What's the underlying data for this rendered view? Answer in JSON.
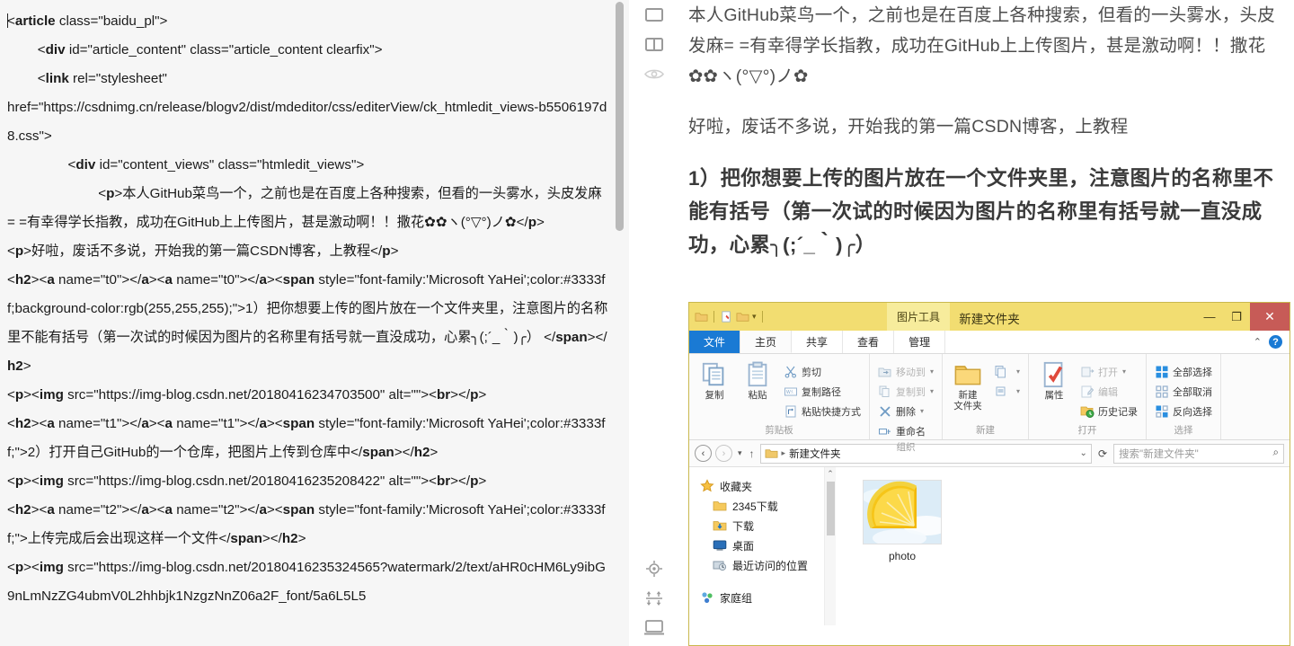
{
  "editor": {
    "code_lines": [
      {
        "text": "<article class=\"baidu_pl\">",
        "indent": 0,
        "caret": true
      },
      {
        "text": "<div id=\"article_content\" class=\"article_content clearfix\">",
        "indent": 1
      },
      {
        "text": "<link rel=\"stylesheet\"",
        "indent": 1
      },
      {
        "text": "href=\"https://csdnimg.cn/release/blogv2/dist/mdeditor/css/editerView/ck_htmledit_views-b5506197d8.css\">",
        "indent": 0
      },
      {
        "text": "<div id=\"content_views\" class=\"htmledit_views\">",
        "indent": 2
      },
      {
        "text": "<p>本人GitHub菜鸟一个，之前也是在百度上各种搜索，但看的一头雾水，头皮发麻= =有幸得学长指教，成功在GitHub上上传图片，甚是激动啊！！撒花✿✿ヽ(°▽°)ノ✿</p>",
        "indent": 3
      },
      {
        "text": "<p>好啦，废话不多说，开始我的第一篇CSDN博客，上教程</p>",
        "indent": 0
      },
      {
        "text": "<h2><a name=\"t0\"></a><a name=\"t0\"></a><span style=\"font-family:'Microsoft YaHei';color:#3333ff;background-color:rgb(255,255,255);\">1）把你想要上传的图片放在一个文件夹里，注意图片的名称里不能有括号（第一次试的时候因为图片的名称里有括号就一直没成功，心累╮(;´_｀)╭） </span></h2>",
        "indent": 0
      },
      {
        "text": "<p><img src=\"https://img-blog.csdn.net/20180416234703500\" alt=\"\"><br></p>",
        "indent": 0
      },
      {
        "text": "<h2><a name=\"t1\"></a><a name=\"t1\"></a><span style=\"font-family:'Microsoft YaHei';color:#3333ff;\">2）打开自己GitHub的一个仓库，把图片上传到仓库中</span></h2>",
        "indent": 0
      },
      {
        "text": "<p><img src=\"https://img-blog.csdn.net/20180416235208422\" alt=\"\"><br></p>",
        "indent": 0
      },
      {
        "text": "<h2><a name=\"t2\"></a><a name=\"t2\"></a><span style=\"font-family:'Microsoft YaHei';color:#3333ff;\">上传完成后会出现这样一个文件</span></h2>",
        "indent": 0
      },
      {
        "text": "<p><img src=\"https://img-blog.csdn.net/20180416235324565?watermark/2/text/aHR0cHM6Ly9ibG9nLmNzZG4ubmV0L2hhbjk1NzgzNnZ06a2F_font/5a6L5L5",
        "indent": 0
      }
    ]
  },
  "rail": {
    "items": [
      {
        "name": "single-pane-icon",
        "title": "single pane"
      },
      {
        "name": "split-pane-icon",
        "title": "split pane"
      },
      {
        "name": "eye-preview-icon",
        "title": "preview"
      }
    ],
    "bottom_items": [
      {
        "name": "target-sync-icon",
        "title": "sync scroll"
      },
      {
        "name": "expand-arrows-icon",
        "title": "fit"
      },
      {
        "name": "monitor-icon",
        "title": "fullscreen"
      }
    ]
  },
  "preview": {
    "paragraph_1": "本人GitHub菜鸟一个，之前也是在百度上各种搜索，但看的一头雾水，头皮发麻= =有幸得学长指教，成功在GitHub上上传图片，甚是激动啊！！撒花✿✿ヽ(°▽°)ノ✿",
    "paragraph_2": "好啦，废话不多说，开始我的第一篇CSDN博客，上教程",
    "heading_1": "1）把你想要上传的图片放在一个文件夹里，注意图片的名称里不能有括号（第一次试的时候因为图片的名称里有括号就一直没成功，心累╮(;´_｀)╭）"
  },
  "explorer": {
    "title": "新建文件夹",
    "contextual_tab": "图片工具",
    "window_buttons": {
      "minimize": "—",
      "maximize": "❐",
      "close": "✕"
    },
    "tabs": [
      {
        "label": "文件",
        "kind": "file"
      },
      {
        "label": "主页",
        "kind": "active"
      },
      {
        "label": "共享",
        "kind": "normal"
      },
      {
        "label": "查看",
        "kind": "normal"
      },
      {
        "label": "管理",
        "kind": "normal"
      }
    ],
    "ribbon_groups": [
      {
        "label": "剪贴板",
        "big_buttons": [
          {
            "label": "复制",
            "icon": "copy-icon"
          },
          {
            "label": "粘贴",
            "icon": "paste-icon"
          }
        ],
        "small_buttons": [
          {
            "label": "剪切",
            "icon": "scissors-icon",
            "dim": false
          },
          {
            "label": "复制路径",
            "icon": "copy-path-icon",
            "dim": false
          },
          {
            "label": "粘贴快捷方式",
            "icon": "paste-shortcut-icon",
            "dim": false
          }
        ]
      },
      {
        "label": "组织",
        "big_buttons": [],
        "small_buttons": [
          {
            "label": "移动到",
            "icon": "move-to-icon",
            "dim": true,
            "caret": true
          },
          {
            "label": "复制到",
            "icon": "copy-to-icon",
            "dim": true,
            "caret": true
          },
          {
            "label": "删除",
            "icon": "delete-icon",
            "dim": false,
            "caret": true
          },
          {
            "label": "重命名",
            "icon": "rename-icon",
            "dim": false
          }
        ]
      },
      {
        "label": "新建",
        "big_buttons": [
          {
            "label": "新建\n文件夹",
            "icon": "new-folder-icon"
          }
        ],
        "small_buttons": [
          {
            "label": "",
            "icon": "new-item-icon",
            "dim": false,
            "caret": true
          },
          {
            "label": "",
            "icon": "easy-access-icon",
            "dim": false,
            "caret": true
          }
        ]
      },
      {
        "label": "打开",
        "big_buttons": [
          {
            "label": "属性",
            "icon": "properties-icon"
          }
        ],
        "small_buttons": [
          {
            "label": "打开",
            "icon": "open-icon",
            "dim": true,
            "caret": true
          },
          {
            "label": "编辑",
            "icon": "edit-icon",
            "dim": true
          },
          {
            "label": "历史记录",
            "icon": "history-icon",
            "dim": false
          }
        ]
      },
      {
        "label": "选择",
        "big_buttons": [],
        "small_buttons": [
          {
            "label": "全部选择",
            "icon": "select-all-icon",
            "dim": false
          },
          {
            "label": "全部取消",
            "icon": "select-none-icon",
            "dim": false
          },
          {
            "label": "反向选择",
            "icon": "invert-selection-icon",
            "dim": false
          }
        ]
      }
    ],
    "address": {
      "path": "新建文件夹",
      "back": "‹",
      "forward": "›",
      "up": "↑",
      "refresh": "⟳",
      "search_placeholder": "搜索\"新建文件夹\""
    },
    "sidebar": [
      {
        "label": "收藏夹",
        "icon": "star-icon",
        "level": 0
      },
      {
        "label": "2345下载",
        "icon": "folder-icon",
        "level": 1
      },
      {
        "label": "下载",
        "icon": "download-folder-icon",
        "level": 1
      },
      {
        "label": "桌面",
        "icon": "desktop-icon",
        "level": 1
      },
      {
        "label": "最近访问的位置",
        "icon": "recent-places-icon",
        "level": 1
      },
      {
        "label": "家庭组",
        "icon": "homegroup-icon",
        "level": 0,
        "gap_before": true
      }
    ],
    "files": [
      {
        "label": "photo",
        "icon": "image-thumbnail"
      }
    ]
  },
  "colors": {
    "title_bar": "#f2dd71",
    "file_tab": "#1a7ad4",
    "close_button": "#c75b57",
    "code_background": "#f6f6f6",
    "preview_text": "#4d4d4d"
  }
}
